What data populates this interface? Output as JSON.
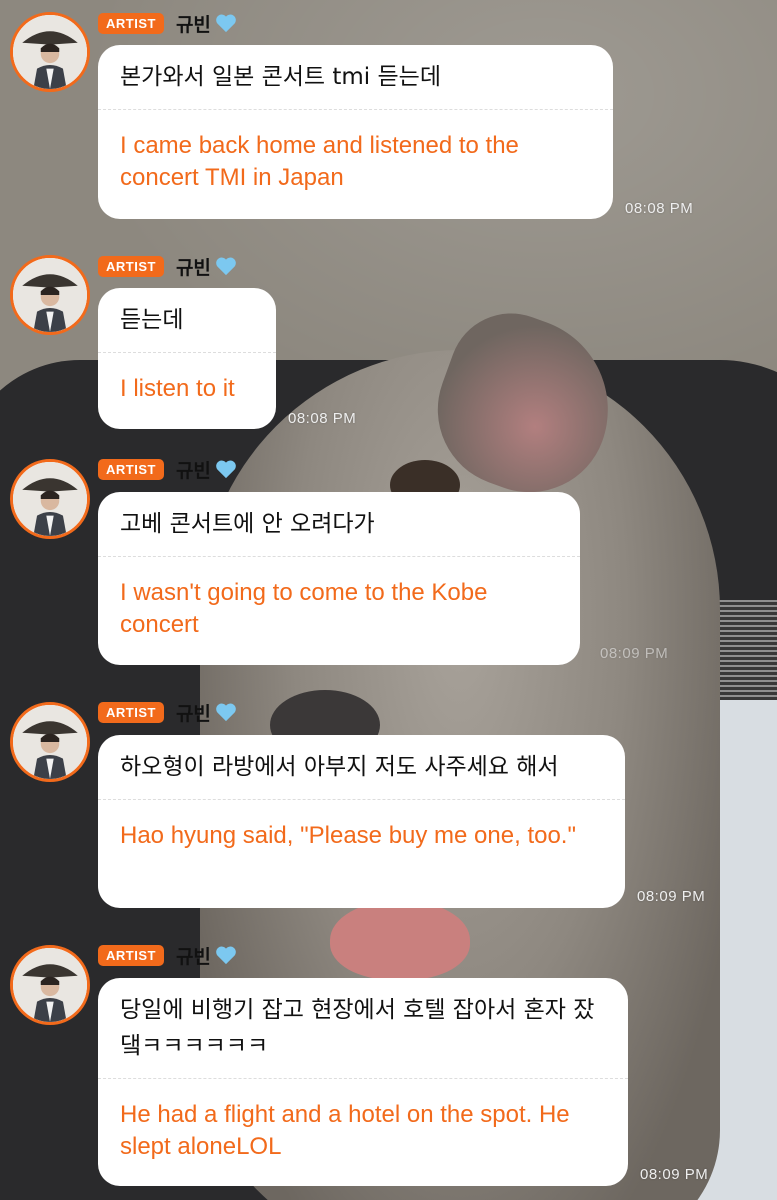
{
  "colors": {
    "accent": "#f26a1b",
    "bubble": "#ffffff",
    "translation": "#f26a1b"
  },
  "messages": [
    {
      "badge": "ARTIST",
      "name": "규빈",
      "heart_icon": "blue-heart-icon",
      "text_ko": "본가와서 일본 콘서트 tmi 듣는데",
      "text_en": "I came back home and listened to the concert TMI in Japan",
      "time": "08:08 PM"
    },
    {
      "badge": "ARTIST",
      "name": "규빈",
      "heart_icon": "blue-heart-icon",
      "text_ko": "듣는데",
      "text_en": "I listen to it",
      "time": "08:08 PM"
    },
    {
      "badge": "ARTIST",
      "name": "규빈",
      "heart_icon": "blue-heart-icon",
      "text_ko": "고베 콘서트에 안 오려다가",
      "text_en": "I wasn't going to come to the Kobe concert",
      "time": "08:09 PM"
    },
    {
      "badge": "ARTIST",
      "name": "규빈",
      "heart_icon": "blue-heart-icon",
      "text_ko": "하오형이 라방에서 아부지 저도 사주세요 해서",
      "text_en": "Hao hyung said, \"Please buy me one, too.\"",
      "time": "08:09 PM"
    },
    {
      "badge": "ARTIST",
      "name": "규빈",
      "heart_icon": "blue-heart-icon",
      "text_ko": "당일에 비행기 잡고 현장에서 호텔 잡아서 혼자 잤댘ㅋㅋㅋㅋㅋㅋ",
      "text_en": "He had a flight and a hotel on the spot. He slept aloneLOL",
      "time": "08:09 PM"
    }
  ]
}
